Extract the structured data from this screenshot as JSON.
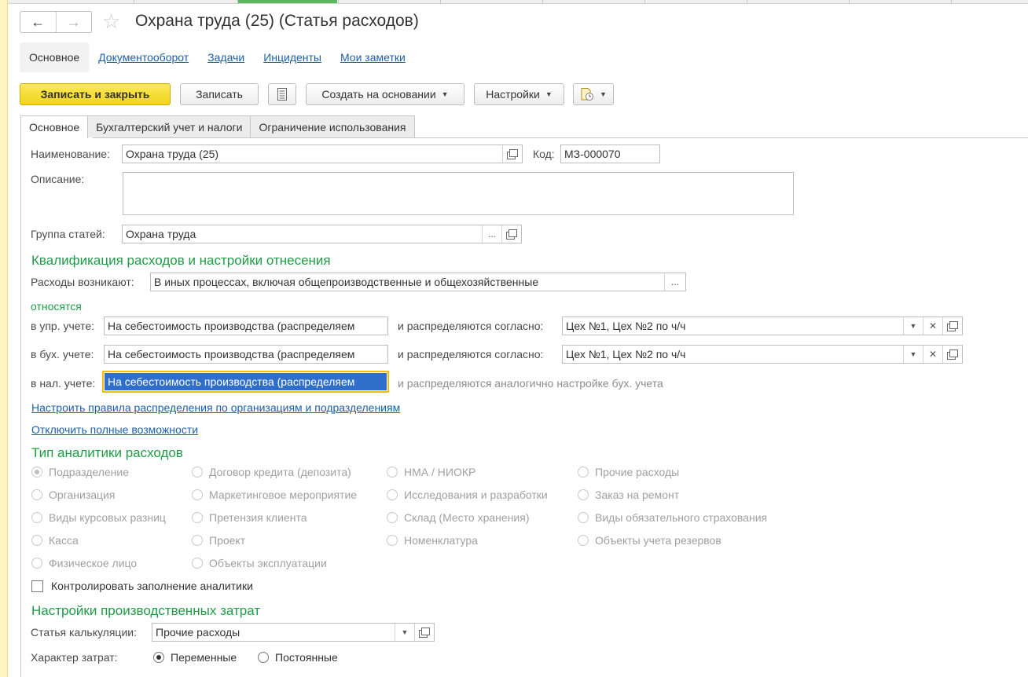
{
  "window": {
    "title": "Охрана труда (25) (Статья расходов)"
  },
  "nav": {
    "back_icon": "arrow-left-icon",
    "forward_icon": "arrow-right-icon",
    "favorite_icon": "star-icon"
  },
  "section_tabs": [
    {
      "label": "Основное",
      "active": true
    },
    {
      "label": "Документооборот",
      "active": false
    },
    {
      "label": "Задачи",
      "active": false
    },
    {
      "label": "Инциденты",
      "active": false
    },
    {
      "label": "Мои заметки",
      "active": false
    }
  ],
  "toolbar": {
    "save_close": "Записать и закрыть",
    "save": "Записать",
    "create_based": "Создать на основании",
    "settings": "Настройки"
  },
  "form_tabs": [
    {
      "label": "Основное",
      "active": true
    },
    {
      "label": "Бухгалтерский учет и налоги",
      "active": false
    },
    {
      "label": "Ограничение использования",
      "active": false
    }
  ],
  "fields": {
    "name_label": "Наименование:",
    "name_value": "Охрана труда (25)",
    "code_label": "Код:",
    "code_value": "МЗ-000070",
    "description_label": "Описание:",
    "description_value": "",
    "group_label": "Группа статей:",
    "group_value": "Охрана труда",
    "ellipsis": "..."
  },
  "qualification": {
    "heading": "Квалификация расходов и настройки отнесения",
    "arise_label": "Расходы возникают:",
    "arise_value": "В иных процессах, включая общепроизводственные и общехозяйственные",
    "relate_label": "относятся",
    "mgmt_label": "в упр. учете:",
    "mgmt_value": "На себестоимость производства (распределяем",
    "mgmt_dist_label": "и распределяются согласно:",
    "mgmt_dist_value": "Цех №1, Цех №2 по ч/ч",
    "acc_label": "в бух. учете:",
    "acc_value": "На себестоимость производства (распределяем",
    "acc_dist_label": "и распределяются согласно:",
    "acc_dist_value": "Цех №1, Цех №2 по ч/ч",
    "tax_label": "в нал. учете:",
    "tax_value": "На себестоимость производства (распределяем",
    "tax_note": "и распределяются аналогично настройке бух. учета",
    "link_rules": "Настроить правила распределения по организациям и подразделениям",
    "link_disable": "Отключить полные возможности"
  },
  "analytics": {
    "heading": "Тип аналитики расходов",
    "options": [
      {
        "label": "Подразделение",
        "checked": true
      },
      {
        "label": "Договор кредита (депозита)",
        "checked": false
      },
      {
        "label": "НМА / НИОКР",
        "checked": false
      },
      {
        "label": "Прочие расходы",
        "checked": false
      },
      {
        "label": "Организация",
        "checked": false
      },
      {
        "label": "Маркетинговое мероприятие",
        "checked": false
      },
      {
        "label": "Исследования и разработки",
        "checked": false
      },
      {
        "label": "Заказ на ремонт",
        "checked": false
      },
      {
        "label": "Виды курсовых разниц",
        "checked": false
      },
      {
        "label": "Претензия клиента",
        "checked": false
      },
      {
        "label": "Склад (Место хранения)",
        "checked": false
      },
      {
        "label": "Виды обязательного страхования",
        "checked": false
      },
      {
        "label": "Касса",
        "checked": false
      },
      {
        "label": "Проект",
        "checked": false
      },
      {
        "label": "Номенклатура",
        "checked": false
      },
      {
        "label": "Объекты учета резервов",
        "checked": false
      },
      {
        "label": "Физическое лицо",
        "checked": false
      },
      {
        "label": "Объекты эксплуатации",
        "checked": false
      }
    ],
    "control_label": "Контролировать заполнение аналитики",
    "control_checked": false
  },
  "production": {
    "heading": "Настройки производственных затрат",
    "costing_label": "Статья калькуляции:",
    "costing_value": "Прочие расходы",
    "nature_label": "Характер затрат:",
    "variable_label": "Переменные",
    "variable_checked": true,
    "fixed_label": "Постоянные",
    "fixed_checked": false
  }
}
